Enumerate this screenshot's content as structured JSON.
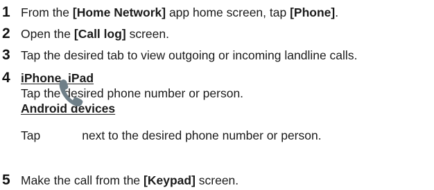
{
  "steps": [
    {
      "number": "1",
      "pre": "From the ",
      "bold1": "[Home Network]",
      "mid": " app home screen, tap ",
      "bold2": "[Phone]",
      "post": "."
    },
    {
      "number": "2",
      "pre": "Open the ",
      "bold1": "[Call log]",
      "post": " screen."
    },
    {
      "number": "3",
      "text": "Tap the desired tab to view outgoing or incoming landline calls."
    },
    {
      "number": "4",
      "heading1": "iPhone, iPad",
      "text1": "Tap the desired phone number or person.",
      "heading2": "Android devices",
      "tap": "Tap",
      "text2": "next to the desired phone number or person."
    },
    {
      "number": "5",
      "pre": "Make the call from the ",
      "bold1": "[Keypad]",
      "post": " screen."
    }
  ],
  "icons": {
    "call": "phone-handset-icon",
    "color": "#6f7f88"
  }
}
